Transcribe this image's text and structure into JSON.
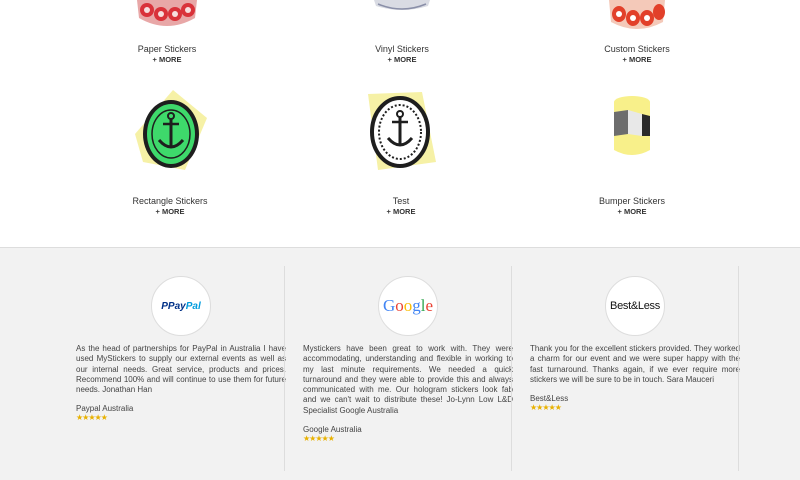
{
  "products": [
    {
      "name": "Paper Stickers",
      "more": "+ MORE"
    },
    {
      "name": "Vinyl Stickers",
      "more": "+ MORE"
    },
    {
      "name": "Custom Stickers",
      "more": "+ MORE"
    },
    {
      "name": "Rectangle Stickers",
      "more": "+ MORE"
    },
    {
      "name": "Test",
      "more": "+ MORE"
    },
    {
      "name": "Bumper Stickers",
      "more": "+ MORE"
    }
  ],
  "testimonials": [
    {
      "logo_text": "PayPal",
      "quote": "As the head of partnerships for PayPal in Australia I have used MyStickers to supply our external events as well as our internal needs. Great service, products and prices. Recommend 100% and will continue to use them for future needs. Jonathan Han",
      "company": "Paypal Australia",
      "stars": "★★★★★"
    },
    {
      "logo_text": "Google",
      "quote": "Mystickers have been great to work with. They were accommodating, understanding and flexible in working to my last minute requirements. We needed a quick turnaround and they were able to provide this and always communicated with me. Our hologram stickers look fab and we can't wait to distribute these! Jo-Lynn Low L&D Specialist Google Australia",
      "company": "Google Australia",
      "stars": "★★★★★"
    },
    {
      "logo_text": "Best&Less",
      "quote": "Thank you for the excellent stickers provided. They worked a charm for our event and we were super happy with the fast turnaround. Thanks again, if we ever require more stickers we will be sure to be in touch. Sara Mauceri",
      "company": "Best&Less",
      "stars": "★★★★★"
    }
  ],
  "colors": {
    "star": "#e8b100",
    "paypal_dark": "#003087",
    "paypal_light": "#009cde",
    "google_blue": "#4285f4",
    "google_red": "#ea4335",
    "google_yellow": "#fbbc05",
    "google_green": "#34a853",
    "sticker_red": "#d9323a",
    "sticker_green": "#3ed96b",
    "sticker_yellow": "#f7f4a0",
    "bumper_yellow": "#f8f08a"
  }
}
